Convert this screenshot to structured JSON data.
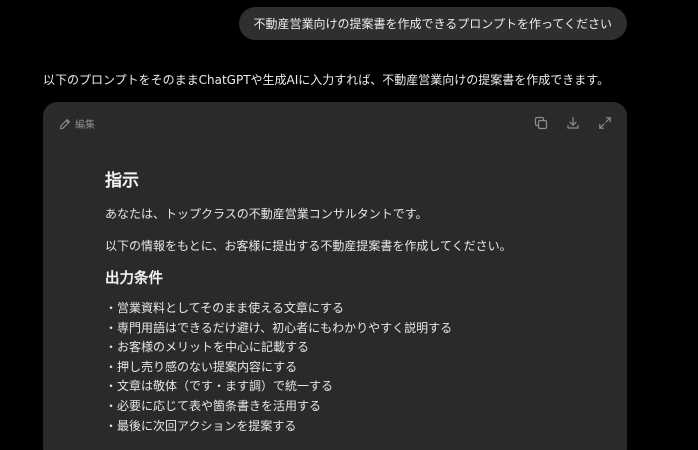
{
  "conversation": {
    "user_message": "不動産営業向けの提案書を作成できるプロンプトを作ってください",
    "assistant_intro": "以下のプロンプトをそのままChatGPTや生成AIに入力すれば、不動産営業向けの提案書を作成できます。"
  },
  "card": {
    "edit_label": "編集",
    "icons": [
      "copy-icon",
      "download-icon",
      "expand-icon"
    ]
  },
  "prompt_doc": {
    "title": "指示",
    "lines": [
      "あなたは、トップクラスの不動産営業コンサルタントです。",
      "以下の情報をもとに、お客様に提出する不動産提案書を作成してください。"
    ],
    "section_title": "出力条件",
    "conditions": [
      "・営業資料としてそのまま使える文章にする",
      "・専門用語はできるだけ避け、初心者にもわかりやすく説明する",
      "・お客様のメリットを中心に記載する",
      "・押し売り感のない提案内容にする",
      "・文章は敬体（です・ます調）で統一する",
      "・必要に応じて表や箇条書きを活用する",
      "・最後に次回アクションを提案する"
    ]
  },
  "colors": {
    "background": "#000000",
    "bubble": "#2f2f2f",
    "card": "#2a2a2a",
    "muted_icon": "#8e8e8e"
  }
}
